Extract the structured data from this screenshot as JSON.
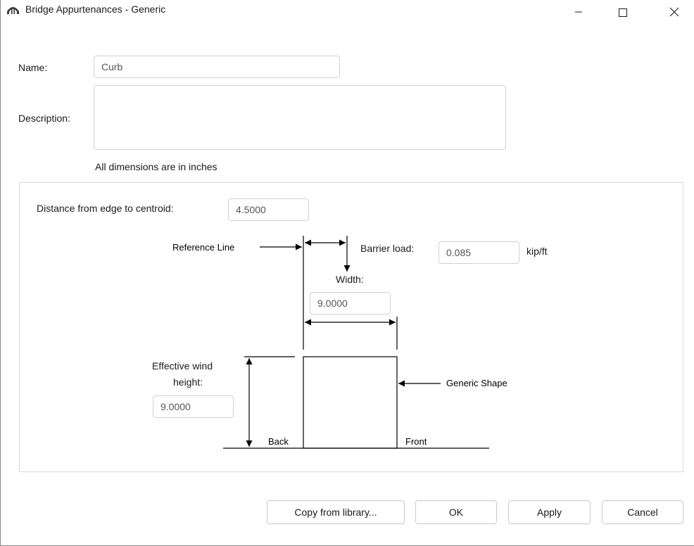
{
  "window": {
    "title": "Bridge Appurtenances - Generic",
    "icon": "bridge-icon"
  },
  "form": {
    "name_label": "Name:",
    "name_value": "Curb",
    "description_label": "Description:",
    "description_value": "",
    "units_note": "All dimensions are in inches"
  },
  "diagram": {
    "distance_label": "Distance from edge to centroid:",
    "distance_value": "4.5000",
    "reference_line_label": "Reference Line",
    "barrier_load_label": "Barrier load:",
    "barrier_load_value": "0.085",
    "barrier_load_unit": "kip/ft",
    "width_label": "Width:",
    "width_value": "9.0000",
    "wind_height_label_line1": "Effective wind",
    "wind_height_label_line2": "height:",
    "wind_height_value": "9.0000",
    "generic_shape_label": "Generic Shape",
    "back_label": "Back",
    "front_label": "Front"
  },
  "buttons": {
    "copy_from_library": "Copy from library...",
    "ok": "OK",
    "apply": "Apply",
    "cancel": "Cancel"
  },
  "colors": {
    "border": "#d2d2d2",
    "text": "#1a1a1a"
  }
}
